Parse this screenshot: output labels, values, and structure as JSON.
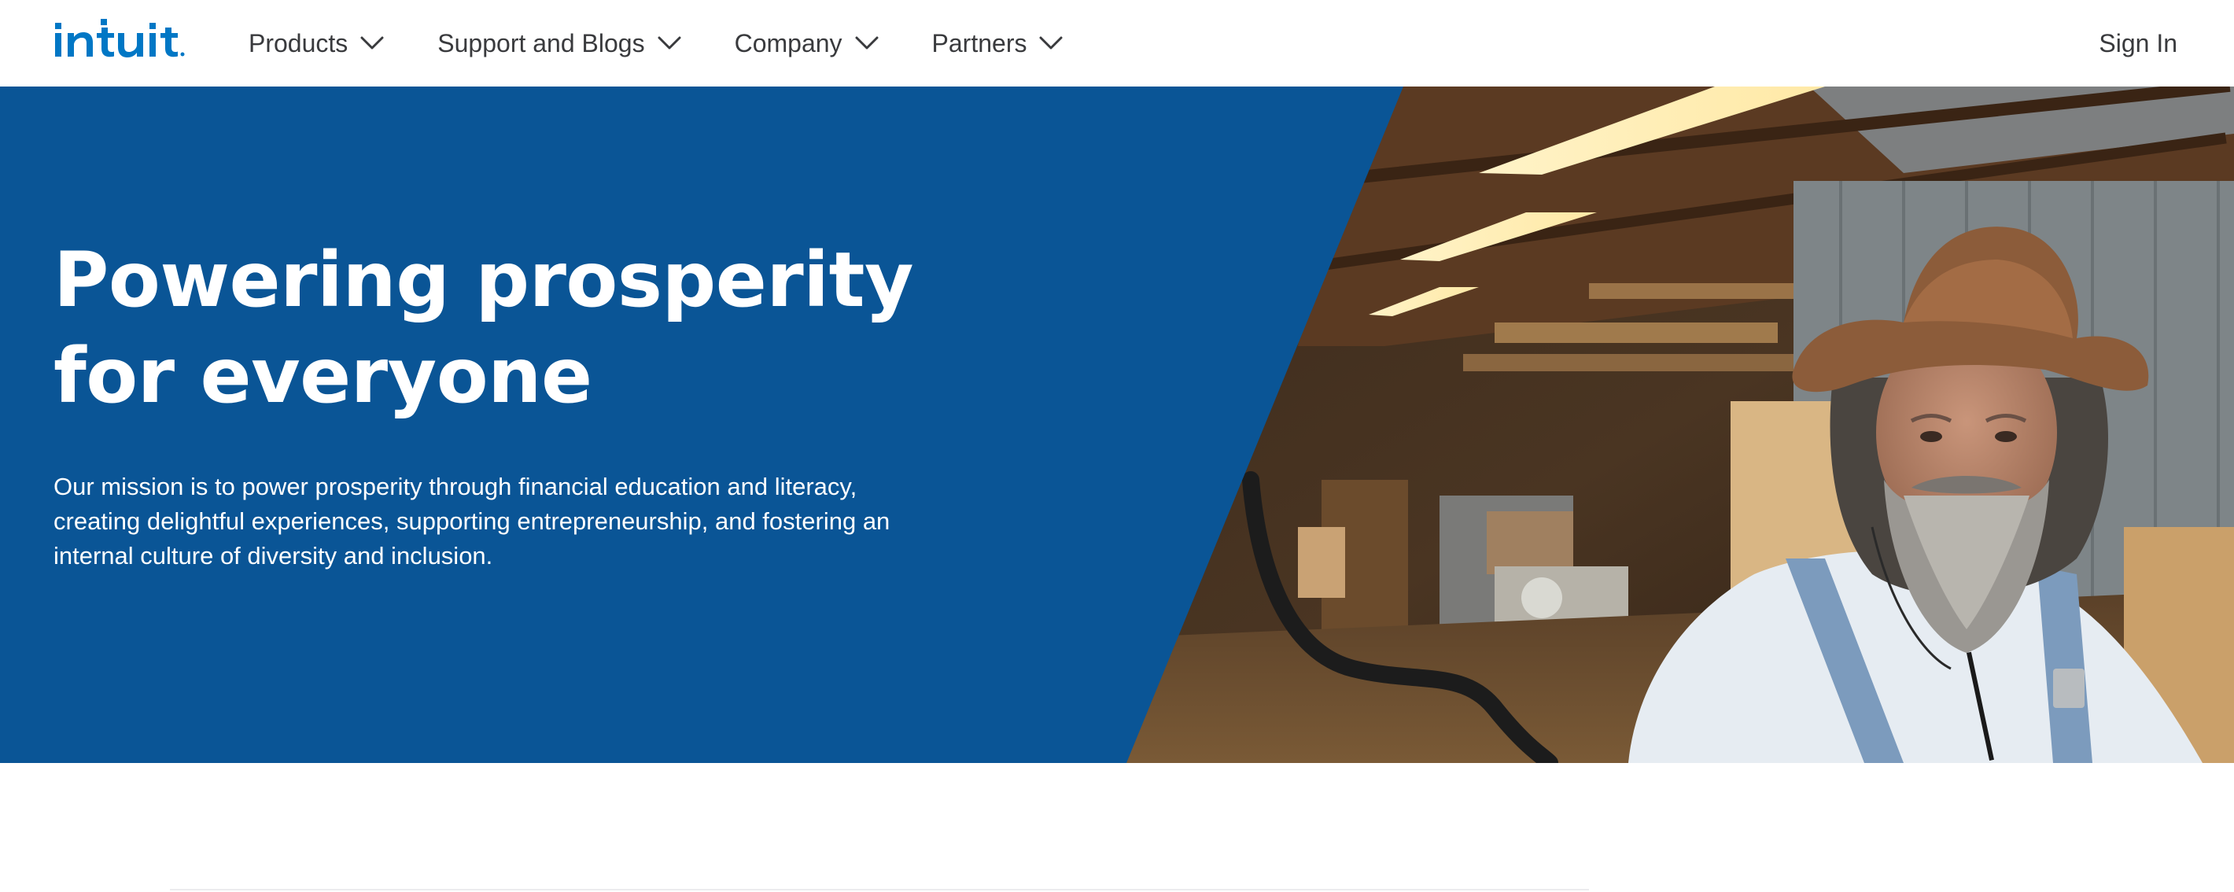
{
  "brand": {
    "logo_text": "intuit",
    "color": "#0077c5"
  },
  "nav": {
    "items": [
      {
        "label": "Products",
        "icon": "chevron-down-icon"
      },
      {
        "label": "Support and Blogs",
        "icon": "chevron-down-icon"
      },
      {
        "label": "Company",
        "icon": "chevron-down-icon"
      },
      {
        "label": "Partners",
        "icon": "chevron-down-icon"
      }
    ],
    "sign_in": "Sign In"
  },
  "hero": {
    "title": "Powering prosperity for everyone",
    "description": "Our mission is to power prosperity through financial education and literacy, creating delightful experiences, supporting entrepreneurship, and fostering an internal culture of diversity and inclusion.",
    "background_color": "#0a5596",
    "image_subject": "woodworker-in-workshop-photo"
  },
  "colors": {
    "text_dark": "#393a3d",
    "hero_blue": "#0a5596",
    "white": "#ffffff"
  }
}
